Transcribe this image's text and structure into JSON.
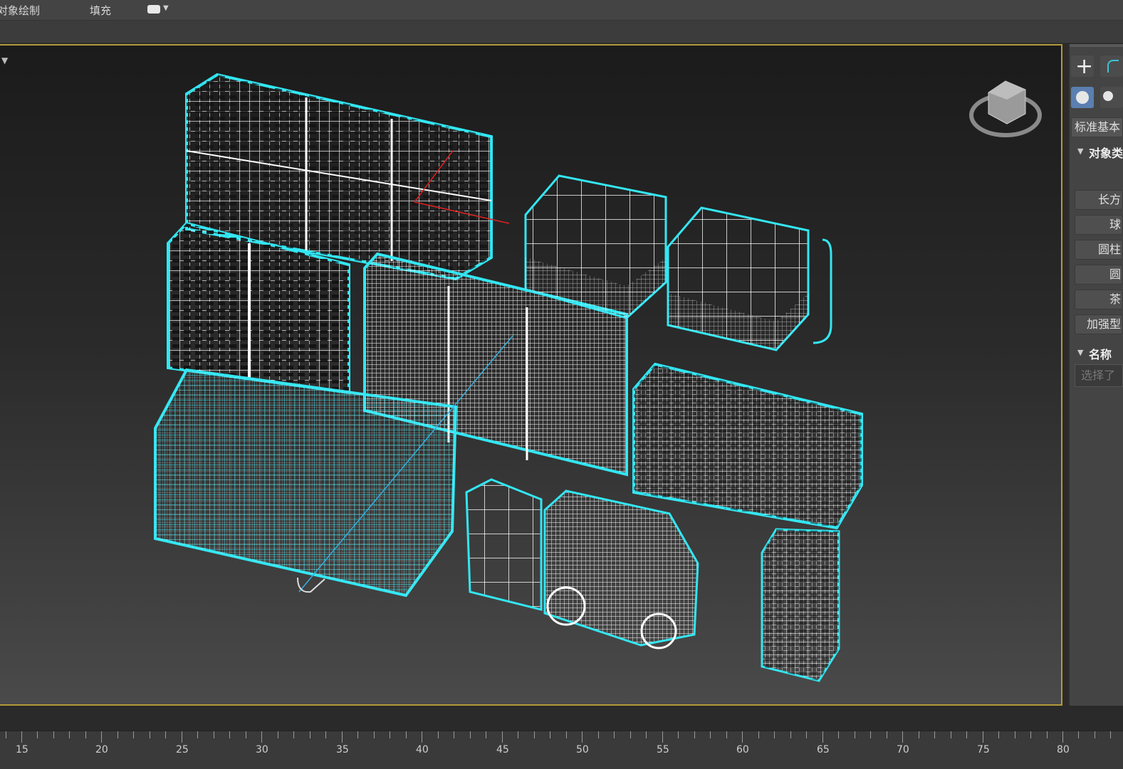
{
  "menu": {
    "object_paint": "对象绘制",
    "fill": "填充"
  },
  "panel": {
    "plus_icon": "+",
    "dropdown_value": "标准基本",
    "section_object_type": "对象类",
    "buttons": [
      "长方",
      "球",
      "圆柱",
      "圆",
      "茶",
      "加强型"
    ],
    "section_name": "名称",
    "name_placeholder": "选择了"
  },
  "timeline": {
    "ticks": [
      "15",
      "20",
      "25",
      "30",
      "35",
      "40",
      "45",
      "50",
      "55",
      "60",
      "65",
      "70",
      "75",
      "80"
    ]
  },
  "colors": {
    "wire_selected": "#33e6f2",
    "wire": "#ffffff",
    "viewport_border": "#b39a3a"
  }
}
